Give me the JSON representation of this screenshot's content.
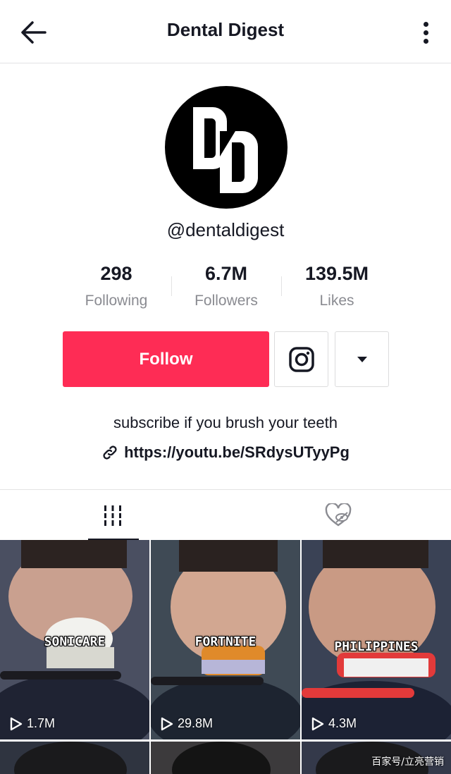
{
  "header": {
    "title": "Dental Digest"
  },
  "profile": {
    "handle": "@dentaldigest",
    "stats": [
      {
        "value": "298",
        "label": "Following"
      },
      {
        "value": "6.7M",
        "label": "Followers"
      },
      {
        "value": "139.5M",
        "label": "Likes"
      }
    ],
    "follow_label": "Follow",
    "bio": "subscribe if you brush your teeth",
    "link": "https://youtu.be/SRdysUTyyPg",
    "accent_color": "#fe2c55"
  },
  "tabs": [
    {
      "icon": "grid-icon",
      "active": true
    },
    {
      "icon": "liked-hidden-icon",
      "active": false
    }
  ],
  "videos": [
    {
      "caption": "SONICARE",
      "views": "1.7M"
    },
    {
      "caption": "FORTNITE",
      "views": "29.8M"
    },
    {
      "caption": "PHILIPPINES",
      "views": "4.3M"
    }
  ],
  "watermark": "百家号/立亮营销"
}
